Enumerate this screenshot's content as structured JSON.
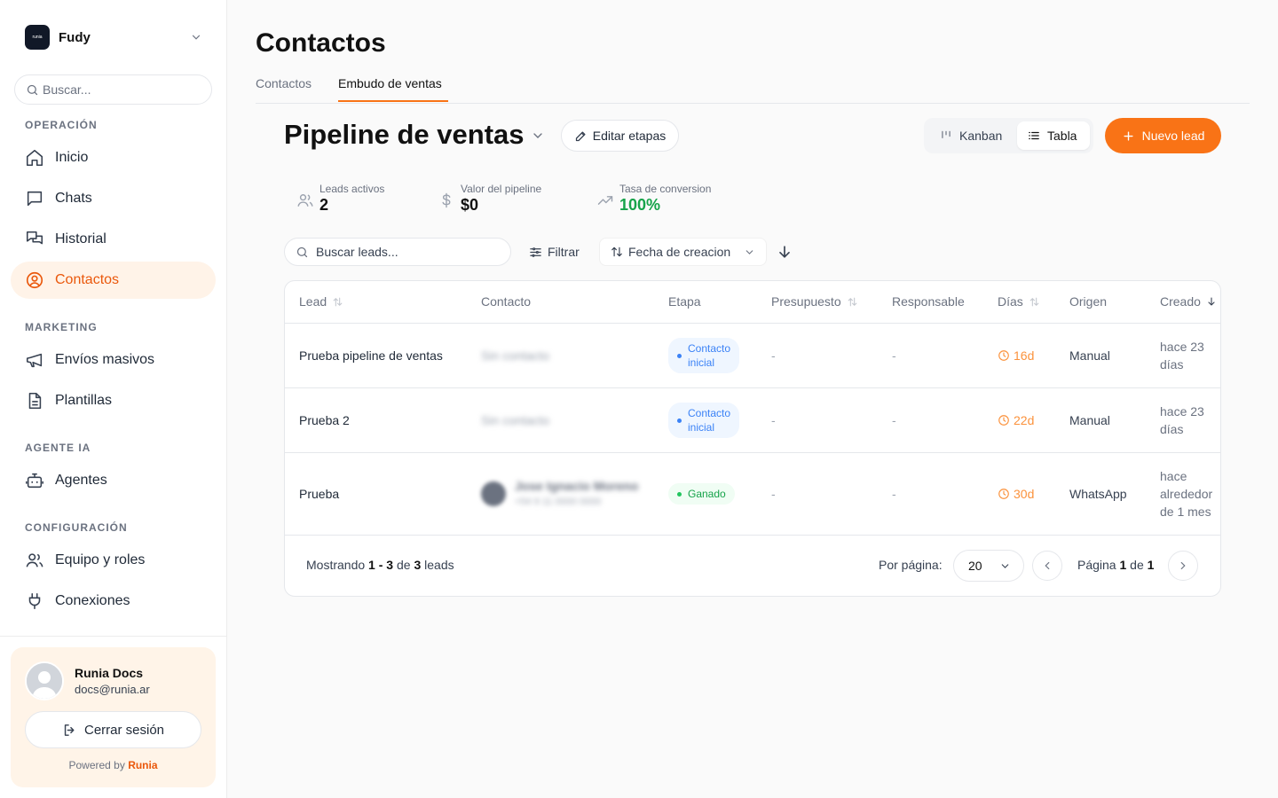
{
  "workspace": {
    "logo_text": "runia",
    "name": "Fudy"
  },
  "sidebar": {
    "search_placeholder": "Buscar...",
    "sections": [
      "OPERACIÓN",
      "MARKETING",
      "AGENTE IA",
      "CONFIGURACIÓN"
    ],
    "items": [
      {
        "label": "Inicio",
        "icon": "home-icon"
      },
      {
        "label": "Chats",
        "icon": "chat-icon"
      },
      {
        "label": "Historial",
        "icon": "history-chat-icon"
      },
      {
        "label": "Contactos",
        "icon": "user-circle-icon",
        "active": true
      },
      {
        "label": "Envíos masivos",
        "icon": "megaphone-icon"
      },
      {
        "label": "Plantillas",
        "icon": "file-text-icon"
      },
      {
        "label": "Agentes",
        "icon": "bot-icon"
      },
      {
        "label": "Equipo y roles",
        "icon": "users-icon"
      },
      {
        "label": "Conexiones",
        "icon": "plug-icon"
      }
    ]
  },
  "user": {
    "name": "Runia Docs",
    "email": "docs@runia.ar",
    "logout_label": "Cerrar sesión",
    "powered_prefix": "Powered by",
    "powered_brand": "Runia"
  },
  "page": {
    "title": "Contactos",
    "tabs": [
      "Contactos",
      "Embudo de ventas"
    ],
    "active_tab": "Embudo de ventas"
  },
  "pipeline": {
    "title": "Pipeline de ventas",
    "edit_label": "Editar etapas",
    "view_kanban": "Kanban",
    "view_table": "Tabla",
    "active_view": "Tabla",
    "new_lead_label": "Nuevo lead"
  },
  "stats": [
    {
      "label": "Leads activos",
      "value": "2"
    },
    {
      "label": "Valor del pipeline",
      "value": "$0"
    },
    {
      "label": "Tasa de conversion",
      "value": "100%"
    }
  ],
  "toolbar": {
    "search_placeholder": "Buscar leads...",
    "filter_label": "Filtrar",
    "sort_label": "Fecha de creacion",
    "sort_direction": "descending"
  },
  "table": {
    "headers": [
      "Lead",
      "Contacto",
      "Etapa",
      "Presupuesto",
      "Responsable",
      "Días",
      "Origen",
      "Creado"
    ],
    "rows": [
      {
        "lead": "Prueba pipeline de ventas",
        "contact": "Sin contacto",
        "contact_sub": "",
        "stage": "Contacto inicial",
        "stage_l1": "Contacto",
        "stage_l2": "inicial",
        "budget": "-",
        "owner": "-",
        "days": "16d",
        "origin": "Manual",
        "created_l1": "hace 23",
        "created_l2": "días",
        "created_l3": ""
      },
      {
        "lead": "Prueba 2",
        "contact": "Sin contacto",
        "contact_sub": "",
        "stage": "Contacto inicial",
        "stage_l1": "Contacto",
        "stage_l2": "inicial",
        "budget": "-",
        "owner": "-",
        "days": "22d",
        "origin": "Manual",
        "created_l1": "hace 23",
        "created_l2": "días",
        "created_l3": ""
      },
      {
        "lead": "Prueba",
        "contact": "Jose Ignacio Moreno",
        "contact_sub": "+54 9 11 0000 0000",
        "stage": "Ganado",
        "stage_l1": "Ganado",
        "stage_l2": "",
        "budget": "-",
        "owner": "-",
        "days": "30d",
        "origin": "WhatsApp",
        "created_l1": "hace",
        "created_l2": "alrededor",
        "created_l3": "de 1 mes"
      }
    ]
  },
  "footer": {
    "showing_prefix": "Mostrando",
    "from": "1",
    "dash": "-",
    "to": "3",
    "of": "de",
    "total": "3",
    "suffix": "leads",
    "per_page_label": "Por página:",
    "per_page_value": "20",
    "page_prefix": "Página",
    "page": "1",
    "page_of": "de",
    "pages": "1"
  },
  "colors": {
    "accent": "#f97316",
    "accent_bg": "#fff3e8",
    "success": "#16a34a",
    "stage_blue": "#3b82f6",
    "days_orange": "#fb923c"
  }
}
